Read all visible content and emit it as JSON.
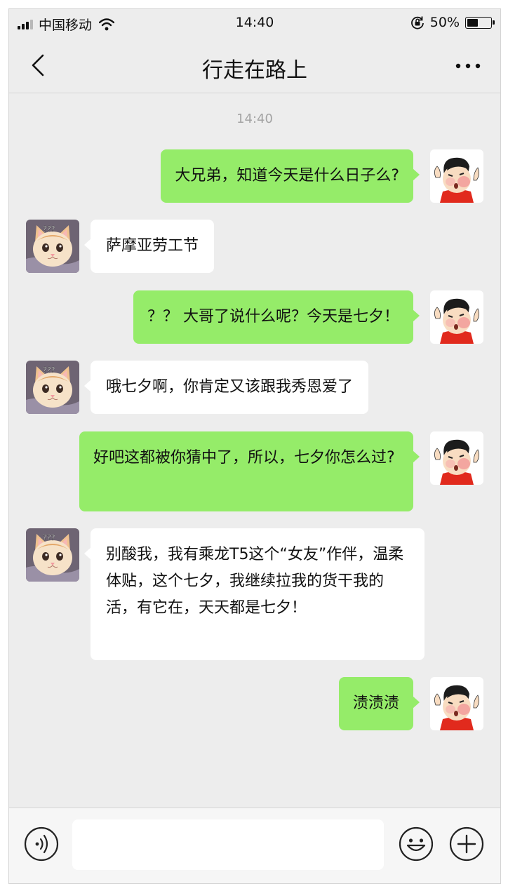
{
  "status_bar": {
    "carrier": "中国移动",
    "time": "14:40",
    "battery": "50%",
    "battery_level": 0.5,
    "icons": [
      "signal-icon",
      "wifi-icon",
      "rotation-lock-icon",
      "battery-icon"
    ]
  },
  "nav": {
    "title": "行走在路上",
    "back_icon": "chevron-left-icon",
    "more_icon": "more-icon"
  },
  "chat": {
    "timestamp": "14:40",
    "messages": [
      {
        "sender": "me",
        "text": "大兄弟，知道今天是什么日子么?"
      },
      {
        "sender": "friend",
        "text": "萨摩亚劳工节"
      },
      {
        "sender": "me",
        "text": "？？ 大哥了说什么呢？今天是七夕！"
      },
      {
        "sender": "friend",
        "text": "哦七夕啊，你肯定又该跟我秀恩爱了"
      },
      {
        "sender": "me",
        "text": "好吧这都被你猜中了，所以，七夕你怎么过?"
      },
      {
        "sender": "friend",
        "text": "别酸我，我有乘龙T5这个“女友”作伴，温柔体贴，这个七夕，我继续拉我的货干我的活，有它在，天天都是七夕！"
      },
      {
        "sender": "me",
        "text": "渍渍渍"
      }
    ]
  },
  "input_bar": {
    "placeholder": "",
    "icons": [
      "voice-icon",
      "emoji-icon",
      "plus-icon"
    ]
  },
  "colors": {
    "outgoing_bubble": "#95ec69",
    "incoming_bubble": "#ffffff",
    "chat_background": "#ededed"
  }
}
